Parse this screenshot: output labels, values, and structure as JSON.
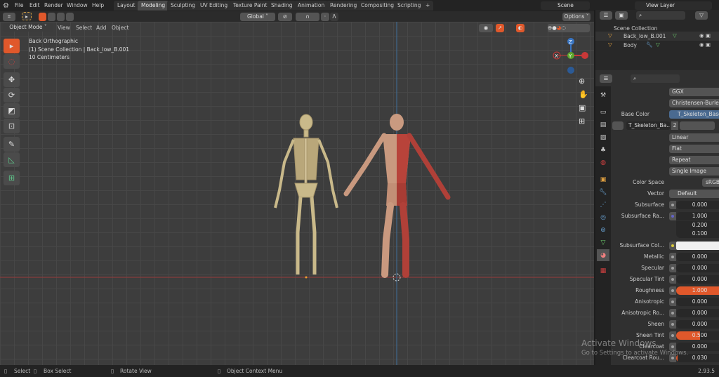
{
  "topbar": {
    "menus": [
      "File",
      "Edit",
      "Render",
      "Window",
      "Help"
    ],
    "tabs": [
      "Layout",
      "Modeling",
      "Sculpting",
      "UV Editing",
      "Texture Paint",
      "Shading",
      "Animation",
      "Rendering",
      "Compositing",
      "Scripting"
    ],
    "active_tab": "Modeling",
    "add_tab": "+",
    "scene": "Scene",
    "view_layer": "View Layer"
  },
  "tool_header": {
    "orientation": "Global",
    "options": "Options"
  },
  "viewport": {
    "mode": "Object Mode",
    "menus": [
      "View",
      "Select",
      "Add",
      "Object"
    ],
    "view_name": "Back Orthographic",
    "collection_info": "(1) Scene Collection | Back_low_B.001",
    "scale": "10 Centimeters",
    "gizmo": {
      "z": "Z",
      "y": "Y",
      "x": "X"
    }
  },
  "outliner": {
    "root": "Scene Collection",
    "items": [
      {
        "name": "Back_low_B.001"
      },
      {
        "name": "Body"
      }
    ]
  },
  "properties": {
    "rows": [
      {
        "type": "select",
        "value": "GGX"
      },
      {
        "type": "select",
        "value": "Christensen-Burley"
      },
      {
        "type": "link",
        "label": "Base Color",
        "value": "T_Skeleton_BaseC..."
      },
      {
        "type": "image",
        "value": "T_Skeleton_Ba...",
        "users": "2"
      },
      {
        "type": "select",
        "value": "Linear"
      },
      {
        "type": "select",
        "value": "Flat"
      },
      {
        "type": "select",
        "value": "Repeat"
      },
      {
        "type": "select",
        "value": "Single Image"
      },
      {
        "type": "small",
        "label": "Color Space",
        "value": "sRGB"
      },
      {
        "type": "link",
        "label": "Vector",
        "value": "Default"
      },
      {
        "type": "num",
        "label": "Subsurface",
        "value": "0.000"
      },
      {
        "type": "vec",
        "label": "Subsurface Ra...",
        "values": [
          "1.000",
          "0.200",
          "0.100"
        ]
      },
      {
        "type": "color",
        "label": "Subsurface Col...",
        "color": "#f0f0f0"
      },
      {
        "type": "num",
        "label": "Metallic",
        "value": "0.000"
      },
      {
        "type": "num",
        "label": "Specular",
        "value": "0.000"
      },
      {
        "type": "num",
        "label": "Specular Tint",
        "value": "0.000"
      },
      {
        "type": "num",
        "label": "Roughness",
        "value": "1.000",
        "fill": 1.0
      },
      {
        "type": "num",
        "label": "Anisotropic",
        "value": "0.000"
      },
      {
        "type": "num",
        "label": "Anisotropic Ro...",
        "value": "0.000"
      },
      {
        "type": "num",
        "label": "Sheen",
        "value": "0.000"
      },
      {
        "type": "num",
        "label": "Sheen Tint",
        "value": "0.500",
        "fill": 0.5
      },
      {
        "type": "num",
        "label": "Clearcoat",
        "value": "0.000"
      },
      {
        "type": "num",
        "label": "Clearcoat Rou...",
        "value": "0.030",
        "fill": 0.03
      }
    ]
  },
  "watermark": {
    "line1": "Activate Windows",
    "line2": "Go to Settings to activate Windows."
  },
  "status": {
    "select": "Select",
    "box_select": "Box Select",
    "rotate": "Rotate View",
    "context": "Object Context Menu",
    "version": "2.93.5"
  },
  "colors": {
    "accent": "#e0582b",
    "x_axis": "#c83838",
    "z_axis": "#3a76c4",
    "y_axis": "#5ea82c"
  }
}
